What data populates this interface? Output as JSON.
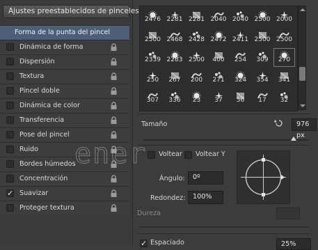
{
  "left": {
    "preset_button": "Ajustes preestablecidos de pinceles",
    "items": [
      {
        "label": "Forma de la punta del pincel",
        "header": true
      },
      {
        "label": "Dinámica de forma",
        "checked": false
      },
      {
        "label": "Dispersión",
        "checked": false
      },
      {
        "label": "Textura",
        "checked": false
      },
      {
        "label": "Pincel doble",
        "checked": false
      },
      {
        "label": "Dinámica de color",
        "checked": false
      },
      {
        "label": "Transferencia",
        "checked": false
      },
      {
        "label": "Pose del pincel",
        "checked": false
      },
      {
        "label": "Ruido",
        "checked": false
      },
      {
        "label": "Bordes húmedos",
        "checked": false
      },
      {
        "label": "Concentración",
        "checked": false
      },
      {
        "label": "Suavizar",
        "checked": true
      },
      {
        "label": "Proteger textura",
        "checked": false
      }
    ]
  },
  "brush_grid": [
    [
      "2476",
      "2281",
      "2281",
      "2040",
      "2040",
      "2500",
      "2000"
    ],
    [
      "2500",
      "2468",
      "2428",
      "2472",
      "2411",
      "2500",
      "2500"
    ],
    [
      "2339",
      "2283",
      "2500",
      "400",
      "254",
      "309",
      "270"
    ],
    [
      "250",
      "267",
      "200",
      "271",
      "324",
      "354",
      "341"
    ],
    [
      "307",
      "336",
      "23",
      "37",
      "56",
      "17",
      "32"
    ]
  ],
  "selected_brush": "270",
  "controls": {
    "tamano_label": "Tamaño",
    "tamano_value": "976 px",
    "voltear_x": "Voltear X",
    "voltear_y": "Voltear Y",
    "angulo_label": "Ángulo:",
    "angulo_value": "0º",
    "redondez_label": "Redondez:",
    "redondez_value": "100%",
    "dureza_label": "Dureza",
    "espaciado_label": "Espaciado",
    "espaciado_value": "25%"
  },
  "watermark": "ener"
}
